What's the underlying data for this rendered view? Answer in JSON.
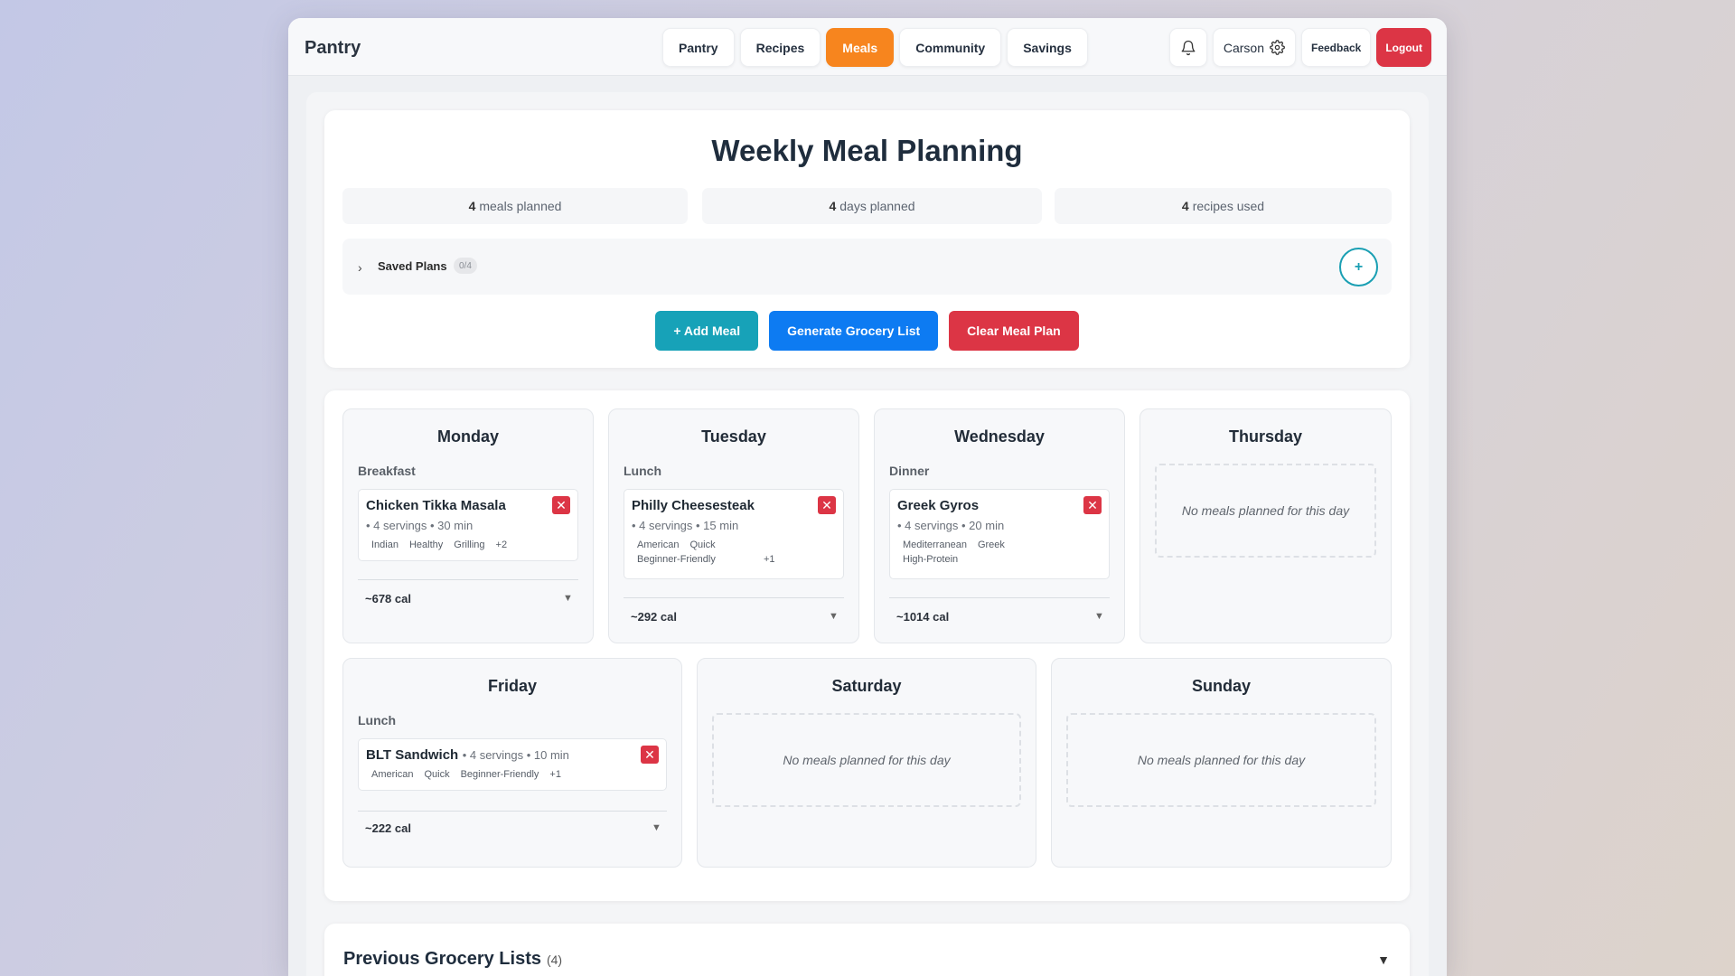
{
  "app": {
    "title": "Pantry"
  },
  "nav": {
    "items": [
      "Pantry",
      "Recipes",
      "Meals",
      "Community",
      "Savings"
    ],
    "active": "Meals"
  },
  "header": {
    "user_name": "Carson",
    "feedback_label": "Feedback",
    "logout_label": "Logout"
  },
  "planner": {
    "title": "Weekly Meal Planning",
    "stats": [
      {
        "count": "4",
        "label": "meals planned"
      },
      {
        "count": "4",
        "label": "days planned"
      },
      {
        "count": "4",
        "label": "recipes used"
      }
    ],
    "saved_plans_label": "Saved Plans",
    "saved_plans_count": "0/4",
    "add_plan_symbol": "+",
    "buttons": {
      "add_meal": "+ Add Meal",
      "generate_grocery": "Generate Grocery List",
      "clear_plan": "Clear Meal Plan"
    }
  },
  "week": {
    "empty_text": "No meals planned for this day",
    "days": [
      {
        "name": "Monday",
        "meal_type": "Breakfast",
        "meal": "Chicken Tikka Masala",
        "meta": "• 4 servings • 30 min",
        "tags": [
          "Indian",
          "Healthy",
          "Grilling",
          "+2"
        ],
        "calories": "~678 cal"
      },
      {
        "name": "Tuesday",
        "meal_type": "Lunch",
        "meal": "Philly Cheesesteak",
        "meta": "• 4 servings • 15 min",
        "tags": [
          "American",
          "Quick",
          "Beginner-Friendly",
          "+1"
        ],
        "calories": "~292 cal"
      },
      {
        "name": "Wednesday",
        "meal_type": "Dinner",
        "meal": "Greek Gyros",
        "meta": "• 4 servings • 20 min",
        "tags": [
          "Mediterranean",
          "Greek",
          "High-Protein"
        ],
        "calories": "~1014 cal"
      },
      {
        "name": "Thursday"
      },
      {
        "name": "Friday",
        "meal_type": "Lunch",
        "meal": "BLT Sandwich",
        "meta": "• 4 servings • 10 min",
        "tags": [
          "American",
          "Quick",
          "Beginner-Friendly",
          "+1"
        ],
        "calories": "~222 cal"
      },
      {
        "name": "Saturday"
      },
      {
        "name": "Sunday"
      }
    ],
    "remove_symbol": "✕",
    "caret_symbol": "▼"
  },
  "previous_lists": {
    "title": "Previous Grocery Lists",
    "count": "(4)"
  },
  "colors": {
    "accent": "#f7851e",
    "teal": "#17a2b8",
    "blue": "#0d7bf2",
    "danger": "#dc3545"
  },
  "icons": {
    "bell": "bell-icon",
    "settings": "gear-icon",
    "expand": "chevron-right-icon",
    "collapse": "caret-down-icon"
  }
}
